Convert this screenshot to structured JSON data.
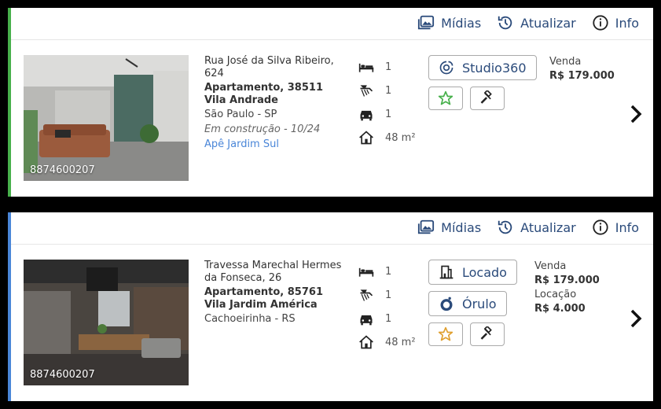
{
  "topbar": {
    "midias_label": "Mídias",
    "atualizar_label": "Atualizar",
    "info_label": "Info"
  },
  "cards": [
    {
      "code": "8874600207",
      "street": "Rua José da Silva Ribeiro, 624",
      "type": "Apartamento, 38511",
      "neighborhood": "Vila Andrade",
      "city": "São Paulo - SP",
      "status": "Em construção - 10/24",
      "development": "Apê Jardim Sul",
      "bedrooms": "1",
      "bathrooms": "1",
      "parking": "1",
      "area": "48 m²",
      "badge": "Studio360",
      "price": {
        "sale_label": "Venda",
        "sale_value": "R$ 179.000"
      },
      "accent_color": "#47b04b"
    },
    {
      "code": "8874600207",
      "street": "Travessa Marechal Hermes da Fonseca, 26",
      "type": "Apartamento, 85761",
      "neighborhood": "Vila Jardim América",
      "city": "Cachoeirinha - RS",
      "bedrooms": "1",
      "bathrooms": "1",
      "parking": "1",
      "area": "48 m²",
      "badge_rented": "Locado",
      "badge_orulo": "Órulo",
      "price": {
        "sale_label": "Venda",
        "sale_value": "R$ 179.000",
        "rent_label": "Locação",
        "rent_value": "R$ 4.000"
      },
      "accent_color": "#4a86d8"
    }
  ],
  "icons": [
    "gallery-icon",
    "history-icon",
    "info-icon",
    "bed-icon",
    "bath-icon",
    "car-icon",
    "house-icon",
    "studio360-icon",
    "star-icon",
    "gavel-icon",
    "building-icon",
    "orulo-icon",
    "chevron-right-icon"
  ],
  "colors": {
    "link": "#2a4a7a",
    "star_green": "#47b04b",
    "star_orange": "#e0a030"
  }
}
